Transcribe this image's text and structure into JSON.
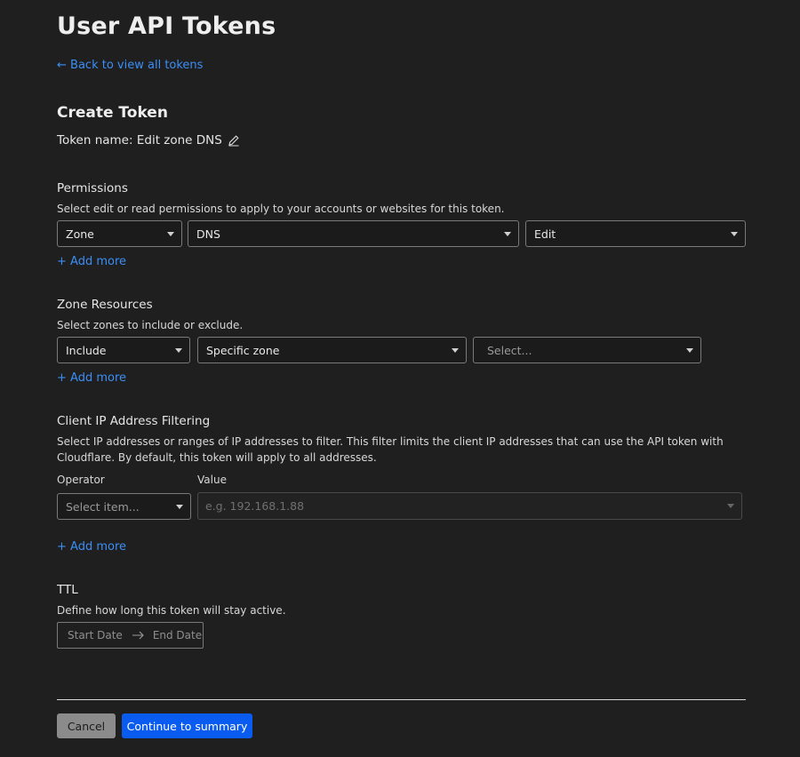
{
  "header": {
    "title": "User API Tokens",
    "back_link": "Back to view all tokens"
  },
  "create": {
    "heading": "Create Token",
    "token_name_label": "Token name:",
    "token_name_value": "Edit zone DNS"
  },
  "permissions": {
    "title": "Permissions",
    "description": "Select edit or read permissions to apply to your accounts or websites for this token.",
    "selects": [
      "Zone",
      "DNS",
      "Edit"
    ],
    "add_more": "Add more"
  },
  "zone_resources": {
    "title": "Zone Resources",
    "description": "Select zones to include or exclude.",
    "selects": [
      "Include",
      "Specific zone"
    ],
    "zone_placeholder": "Select...",
    "add_more": "Add more"
  },
  "ip_filtering": {
    "title": "Client IP Address Filtering",
    "description": "Select IP addresses or ranges of IP addresses to filter. This filter limits the client IP addresses that can use the API token with Cloudflare. By default, this token will apply to all addresses.",
    "operator_label": "Operator",
    "operator_placeholder": "Select item...",
    "value_label": "Value",
    "value_placeholder": "e.g. 192.168.1.88",
    "add_more": "Add more"
  },
  "ttl": {
    "title": "TTL",
    "description": "Define how long this token will stay active.",
    "start_placeholder": "Start Date",
    "end_placeholder": "End Date"
  },
  "footer": {
    "cancel_label": "Cancel",
    "continue_label": "Continue to summary"
  },
  "icons": {
    "back": "arrow-left-icon",
    "edit": "pencil-icon",
    "add": "plus-icon",
    "dropdown": "caret-down-icon",
    "range": "arrow-right-icon"
  },
  "colors": {
    "background": "#1f1f1f",
    "link": "#3b8ef5",
    "primary_button": "#0a5cf0",
    "cancel_button": "#8b8b8b"
  }
}
